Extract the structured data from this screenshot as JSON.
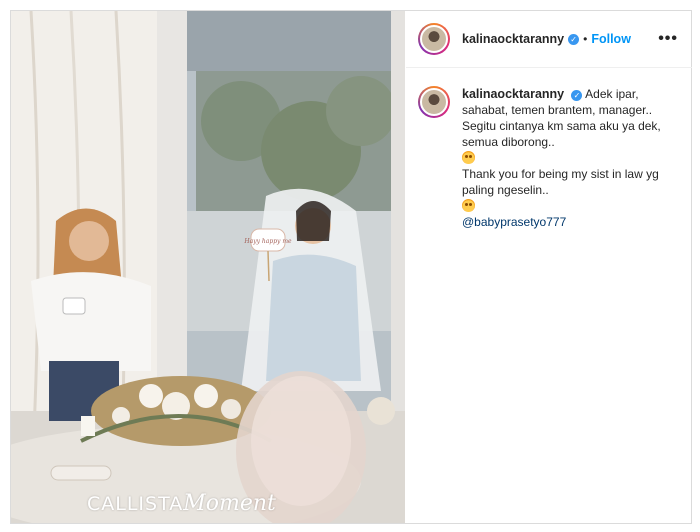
{
  "post": {
    "username": "kalinaocktaranny",
    "follow_label": "Follow",
    "separator": "•",
    "more_label": "•••",
    "verified_label": "✓"
  },
  "photo": {
    "watermark_brand": "CALLISTA",
    "watermark_script": "Moment",
    "sign_text": "Hayy happy me"
  },
  "caption": {
    "username": "kalinaocktaranny",
    "line1": "Adek ipar,",
    "line2": "sahabat, temen brantem, manager..",
    "line3": "Segitu cintanya km sama aku ya dek,",
    "line4": "semua diborong..",
    "line5": "Thank you for being my sist in law yg",
    "line6": "paling ngeselin..",
    "mention": "@babyprasetyo777",
    "emoji_icon": "smiling-face-with-heart-eyes-icon"
  },
  "colors": {
    "accent": "#0095f6",
    "verified": "#3897f0",
    "mention": "#00376b"
  }
}
